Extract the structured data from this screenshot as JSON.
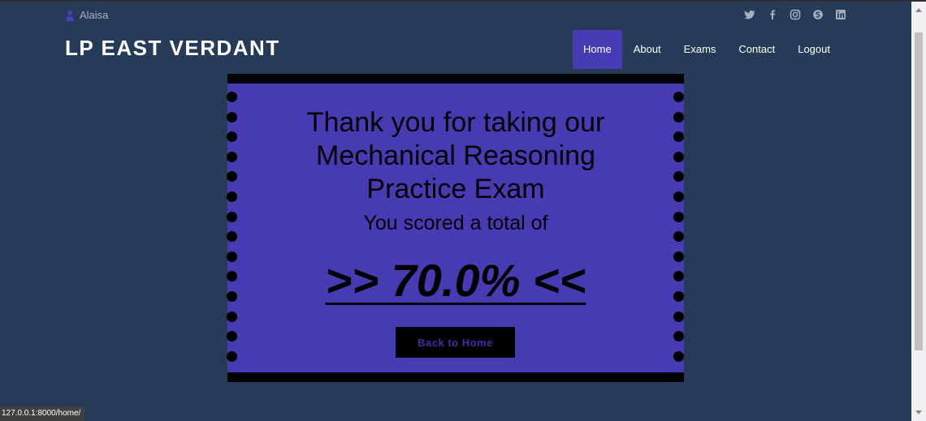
{
  "user": {
    "name": "Alaisa"
  },
  "social": {
    "icons": [
      "twitter-icon",
      "facebook-icon",
      "instagram-icon",
      "skype-icon",
      "linkedin-icon"
    ],
    "color": "#a7afbd"
  },
  "brand": {
    "title": "LP EAST VERDANT"
  },
  "nav": {
    "items": [
      {
        "label": "Home",
        "active": true
      },
      {
        "label": "About"
      },
      {
        "label": "Exams"
      },
      {
        "label": "Contact"
      },
      {
        "label": "Logout"
      }
    ]
  },
  "result": {
    "message": "Thank you for taking our Mechanical Reasoning Practice Exam",
    "subtitle": "You scored a total of",
    "score": ">> 70.0% <<",
    "back_label": "Back to Home"
  },
  "status_bar": {
    "url": "127.0.0.1:8000/home/"
  },
  "colors": {
    "background": "#263b58",
    "accent": "#473bb3",
    "card": "#473bb3",
    "ticket_border": "#000000"
  }
}
